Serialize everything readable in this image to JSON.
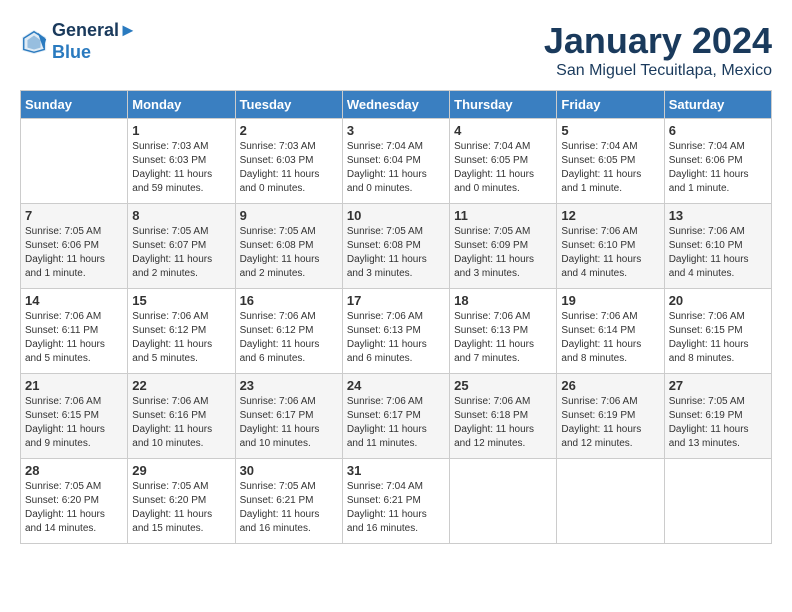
{
  "header": {
    "logo_line1": "General",
    "logo_line2": "Blue",
    "month_year": "January 2024",
    "location": "San Miguel Tecuitlapa, Mexico"
  },
  "weekdays": [
    "Sunday",
    "Monday",
    "Tuesday",
    "Wednesday",
    "Thursday",
    "Friday",
    "Saturday"
  ],
  "weeks": [
    [
      {
        "day": "",
        "sunrise": "",
        "sunset": "",
        "daylight": ""
      },
      {
        "day": "1",
        "sunrise": "Sunrise: 7:03 AM",
        "sunset": "Sunset: 6:03 PM",
        "daylight": "Daylight: 11 hours and 59 minutes."
      },
      {
        "day": "2",
        "sunrise": "Sunrise: 7:03 AM",
        "sunset": "Sunset: 6:03 PM",
        "daylight": "Daylight: 11 hours and 0 minutes."
      },
      {
        "day": "3",
        "sunrise": "Sunrise: 7:04 AM",
        "sunset": "Sunset: 6:04 PM",
        "daylight": "Daylight: 11 hours and 0 minutes."
      },
      {
        "day": "4",
        "sunrise": "Sunrise: 7:04 AM",
        "sunset": "Sunset: 6:05 PM",
        "daylight": "Daylight: 11 hours and 0 minutes."
      },
      {
        "day": "5",
        "sunrise": "Sunrise: 7:04 AM",
        "sunset": "Sunset: 6:05 PM",
        "daylight": "Daylight: 11 hours and 1 minute."
      },
      {
        "day": "6",
        "sunrise": "Sunrise: 7:04 AM",
        "sunset": "Sunset: 6:06 PM",
        "daylight": "Daylight: 11 hours and 1 minute."
      }
    ],
    [
      {
        "day": "7",
        "sunrise": "Sunrise: 7:05 AM",
        "sunset": "Sunset: 6:06 PM",
        "daylight": "Daylight: 11 hours and 1 minute."
      },
      {
        "day": "8",
        "sunrise": "Sunrise: 7:05 AM",
        "sunset": "Sunset: 6:07 PM",
        "daylight": "Daylight: 11 hours and 2 minutes."
      },
      {
        "day": "9",
        "sunrise": "Sunrise: 7:05 AM",
        "sunset": "Sunset: 6:08 PM",
        "daylight": "Daylight: 11 hours and 2 minutes."
      },
      {
        "day": "10",
        "sunrise": "Sunrise: 7:05 AM",
        "sunset": "Sunset: 6:08 PM",
        "daylight": "Daylight: 11 hours and 3 minutes."
      },
      {
        "day": "11",
        "sunrise": "Sunrise: 7:05 AM",
        "sunset": "Sunset: 6:09 PM",
        "daylight": "Daylight: 11 hours and 3 minutes."
      },
      {
        "day": "12",
        "sunrise": "Sunrise: 7:06 AM",
        "sunset": "Sunset: 6:10 PM",
        "daylight": "Daylight: 11 hours and 4 minutes."
      },
      {
        "day": "13",
        "sunrise": "Sunrise: 7:06 AM",
        "sunset": "Sunset: 6:10 PM",
        "daylight": "Daylight: 11 hours and 4 minutes."
      }
    ],
    [
      {
        "day": "14",
        "sunrise": "Sunrise: 7:06 AM",
        "sunset": "Sunset: 6:11 PM",
        "daylight": "Daylight: 11 hours and 5 minutes."
      },
      {
        "day": "15",
        "sunrise": "Sunrise: 7:06 AM",
        "sunset": "Sunset: 6:12 PM",
        "daylight": "Daylight: 11 hours and 5 minutes."
      },
      {
        "day": "16",
        "sunrise": "Sunrise: 7:06 AM",
        "sunset": "Sunset: 6:12 PM",
        "daylight": "Daylight: 11 hours and 6 minutes."
      },
      {
        "day": "17",
        "sunrise": "Sunrise: 7:06 AM",
        "sunset": "Sunset: 6:13 PM",
        "daylight": "Daylight: 11 hours and 6 minutes."
      },
      {
        "day": "18",
        "sunrise": "Sunrise: 7:06 AM",
        "sunset": "Sunset: 6:13 PM",
        "daylight": "Daylight: 11 hours and 7 minutes."
      },
      {
        "day": "19",
        "sunrise": "Sunrise: 7:06 AM",
        "sunset": "Sunset: 6:14 PM",
        "daylight": "Daylight: 11 hours and 8 minutes."
      },
      {
        "day": "20",
        "sunrise": "Sunrise: 7:06 AM",
        "sunset": "Sunset: 6:15 PM",
        "daylight": "Daylight: 11 hours and 8 minutes."
      }
    ],
    [
      {
        "day": "21",
        "sunrise": "Sunrise: 7:06 AM",
        "sunset": "Sunset: 6:15 PM",
        "daylight": "Daylight: 11 hours and 9 minutes."
      },
      {
        "day": "22",
        "sunrise": "Sunrise: 7:06 AM",
        "sunset": "Sunset: 6:16 PM",
        "daylight": "Daylight: 11 hours and 10 minutes."
      },
      {
        "day": "23",
        "sunrise": "Sunrise: 7:06 AM",
        "sunset": "Sunset: 6:17 PM",
        "daylight": "Daylight: 11 hours and 10 minutes."
      },
      {
        "day": "24",
        "sunrise": "Sunrise: 7:06 AM",
        "sunset": "Sunset: 6:17 PM",
        "daylight": "Daylight: 11 hours and 11 minutes."
      },
      {
        "day": "25",
        "sunrise": "Sunrise: 7:06 AM",
        "sunset": "Sunset: 6:18 PM",
        "daylight": "Daylight: 11 hours and 12 minutes."
      },
      {
        "day": "26",
        "sunrise": "Sunrise: 7:06 AM",
        "sunset": "Sunset: 6:19 PM",
        "daylight": "Daylight: 11 hours and 12 minutes."
      },
      {
        "day": "27",
        "sunrise": "Sunrise: 7:05 AM",
        "sunset": "Sunset: 6:19 PM",
        "daylight": "Daylight: 11 hours and 13 minutes."
      }
    ],
    [
      {
        "day": "28",
        "sunrise": "Sunrise: 7:05 AM",
        "sunset": "Sunset: 6:20 PM",
        "daylight": "Daylight: 11 hours and 14 minutes."
      },
      {
        "day": "29",
        "sunrise": "Sunrise: 7:05 AM",
        "sunset": "Sunset: 6:20 PM",
        "daylight": "Daylight: 11 hours and 15 minutes."
      },
      {
        "day": "30",
        "sunrise": "Sunrise: 7:05 AM",
        "sunset": "Sunset: 6:21 PM",
        "daylight": "Daylight: 11 hours and 16 minutes."
      },
      {
        "day": "31",
        "sunrise": "Sunrise: 7:04 AM",
        "sunset": "Sunset: 6:21 PM",
        "daylight": "Daylight: 11 hours and 16 minutes."
      },
      {
        "day": "",
        "sunrise": "",
        "sunset": "",
        "daylight": ""
      },
      {
        "day": "",
        "sunrise": "",
        "sunset": "",
        "daylight": ""
      },
      {
        "day": "",
        "sunrise": "",
        "sunset": "",
        "daylight": ""
      }
    ]
  ]
}
